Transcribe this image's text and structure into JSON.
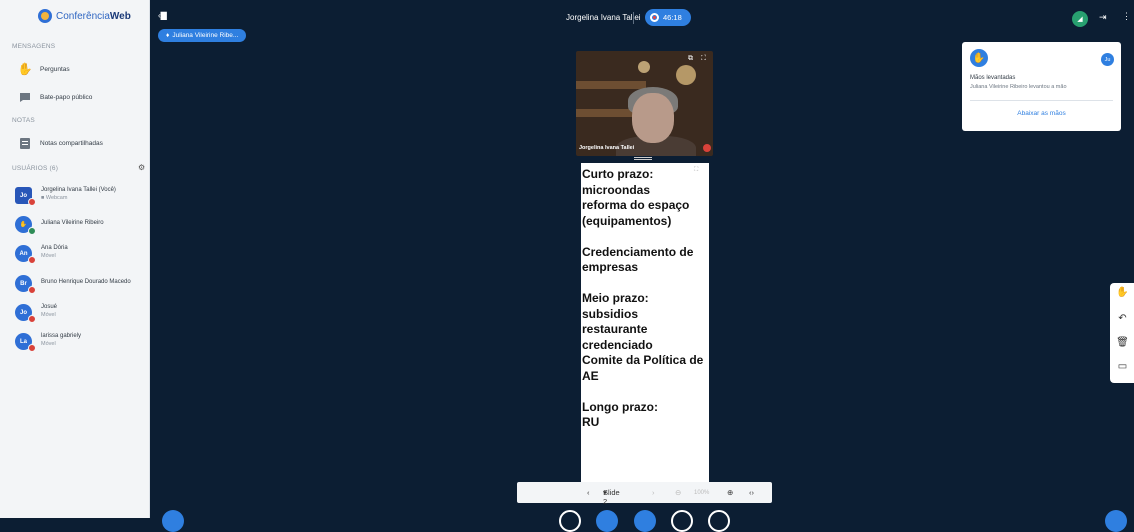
{
  "app": {
    "logo_text_a": "Conferência",
    "logo_text_b": "Web"
  },
  "sidebar": {
    "messages_title": "MENSAGENS",
    "messages": [
      {
        "label": "Perguntas",
        "icon": "hand-icon"
      },
      {
        "label": "Bate-papo público",
        "icon": "chat-icon"
      }
    ],
    "notes_title": "NOTAS",
    "notes": [
      {
        "label": "Notas compartilhadas",
        "icon": "notes-icon"
      }
    ],
    "users_title": "USUÁRIOS (6)",
    "users": [
      {
        "initials": "Jo",
        "name": "Jorgelina Ivana Tallei (Você)",
        "status": "■ Webcam"
      },
      {
        "initials": "",
        "name": "Juliana Vileirine Ribeiro",
        "status": ""
      },
      {
        "initials": "An",
        "name": "Ana Dória",
        "status": "Móvel"
      },
      {
        "initials": "Br",
        "name": "Bruno Henrique Dourado Macedo",
        "status": ""
      },
      {
        "initials": "Jo",
        "name": "Josué",
        "status": "Móvel"
      },
      {
        "initials": "La",
        "name": "larissa gabriely",
        "status": "Móvel"
      }
    ]
  },
  "topbar": {
    "presenter_pill": "Juliana Vileirine Ribe...",
    "meeting_title": "Jorgelina Ivana Tallei",
    "timer": "46:18"
  },
  "webcam": {
    "name": "Jorgelina Ivana Tallei"
  },
  "slide": {
    "lines": [
      "Curto prazo:",
      "microondas",
      "reforma do espaço",
      "(equipamentos)",
      "",
      "Credenciamento de",
      "empresas",
      "",
      "Meio prazo:",
      "subsidios restaurante",
      "credenciado",
      "Comite da Política de",
      "AE",
      "",
      "Longo prazo:",
      "RU"
    ]
  },
  "slide_nav": {
    "slide_label": "Slide 2",
    "zoom": "100%"
  },
  "notification": {
    "avatar_initials": "Ju",
    "title": "Mãos levantadas",
    "message": "Juliana Vileirine Ribeiro levantou a mão",
    "action": "Abaixar as mãos"
  },
  "colors": {
    "accent": "#2f7fe0",
    "background": "#0c1e33",
    "sidebar": "#f3f5f7",
    "alert": "#d9423a"
  }
}
